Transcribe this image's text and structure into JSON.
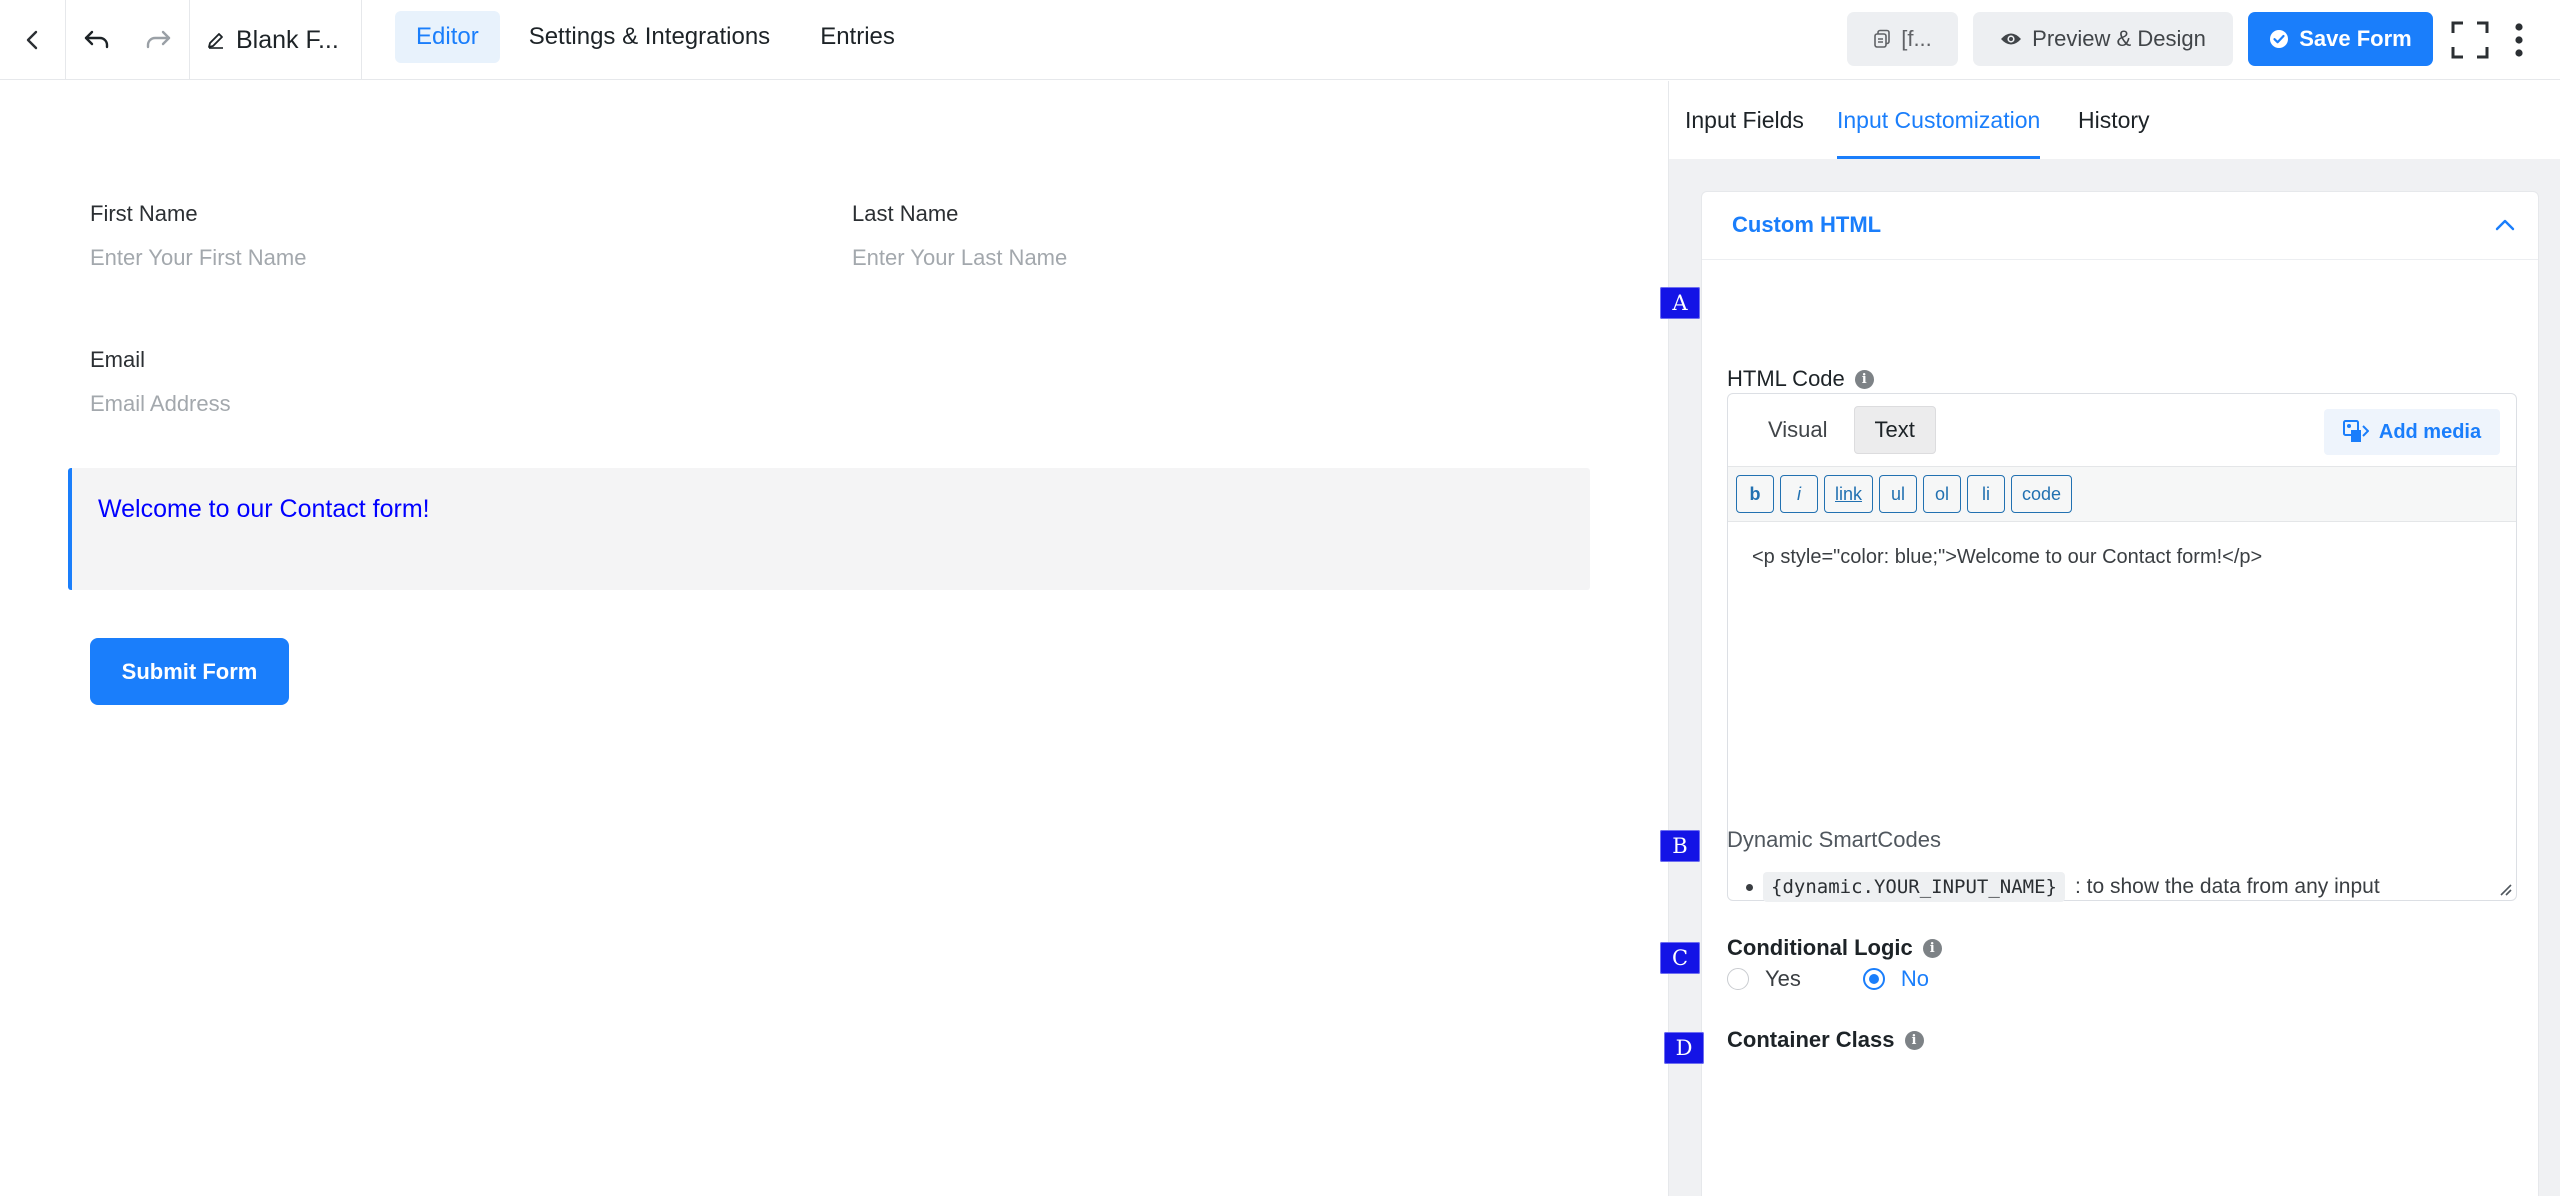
{
  "topbar": {
    "form_name": "Blank F...",
    "tabs": [
      {
        "label": "Editor",
        "active": true
      },
      {
        "label": "Settings & Integrations",
        "active": false
      },
      {
        "label": "Entries",
        "active": false
      }
    ],
    "shortcode_label": "[f...",
    "preview_label": "Preview & Design",
    "save_label": "Save Form"
  },
  "form": {
    "first_name": {
      "label": "First Name",
      "placeholder": "Enter Your First Name"
    },
    "last_name": {
      "label": "Last Name",
      "placeholder": "Enter Your Last Name"
    },
    "email": {
      "label": "Email",
      "placeholder": "Email Address"
    },
    "custom_html_text": "Welcome to our Contact form!",
    "html_text_color": "#0000ff",
    "submit_label": "Submit Form"
  },
  "panel": {
    "tabs": [
      {
        "label": "Input Fields",
        "active": false
      },
      {
        "label": "Input Customization",
        "active": true
      },
      {
        "label": "History",
        "active": false
      }
    ],
    "section_title": "Custom HTML",
    "html_code": {
      "label": "HTML Code",
      "editor_tabs": [
        {
          "label": "Visual",
          "active": false
        },
        {
          "label": "Text",
          "active": true
        }
      ],
      "add_media_label": "Add media",
      "quicktags": [
        "b",
        "i",
        "link",
        "ul",
        "ol",
        "li",
        "code"
      ],
      "content": "<p style=\"color: blue;\">Welcome to our Contact form!</p>"
    },
    "smartcodes": {
      "label": "Dynamic SmartCodes",
      "code": "{dynamic.YOUR_INPUT_NAME}",
      "description": ": to show the data from any input"
    },
    "conditional_logic": {
      "label": "Conditional Logic",
      "options": [
        {
          "label": "Yes",
          "selected": false
        },
        {
          "label": "No",
          "selected": true
        }
      ]
    },
    "container_class": {
      "label": "Container Class"
    }
  },
  "markers": [
    "A",
    "B",
    "C",
    "D"
  ],
  "colors": {
    "accent": "#1a7efb",
    "marker": "#1414e6"
  }
}
